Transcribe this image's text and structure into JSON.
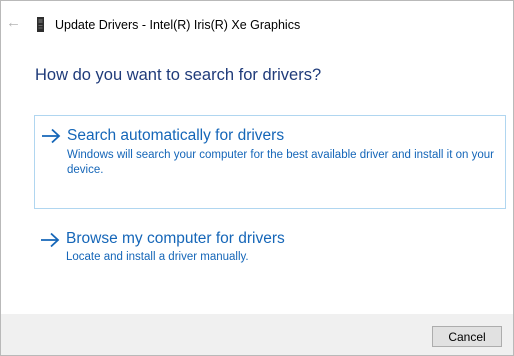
{
  "window": {
    "title": "Update Drivers - Intel(R) Iris(R) Xe Graphics"
  },
  "heading": "How do you want to search for drivers?",
  "options": [
    {
      "title": "Search automatically for drivers",
      "description": "Windows will search your computer for the best available driver and install it on your device."
    },
    {
      "title": "Browse my computer for drivers",
      "description": "Locate and install a driver manually."
    }
  ],
  "footer": {
    "cancel_label": "Cancel"
  },
  "colors": {
    "heading": "#1f3b7a",
    "link": "#1566b8",
    "selected_border": "#b0d6f0",
    "footer_bg": "#f0f0f0"
  },
  "icons": {
    "back": "back-arrow-icon",
    "device": "graphics-device-icon",
    "option_arrow": "right-arrow-icon"
  }
}
